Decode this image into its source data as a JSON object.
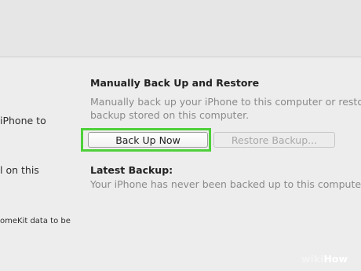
{
  "left_panel": {
    "lines": [
      "iPhone to",
      "l on this",
      "omeKit data to be"
    ]
  },
  "backup_section": {
    "heading": "Manually Back Up and Restore",
    "description_line1": "Manually back up your iPhone to this computer or restor",
    "description_line2": "backup stored on this computer.",
    "back_up_now_label": "Back Up Now",
    "restore_backup_label": "Restore Backup..."
  },
  "latest_backup": {
    "heading": "Latest Backup:",
    "status": "Your iPhone has never been backed up to this computer."
  },
  "watermark": {
    "prefix": "wiki",
    "suffix": "How"
  },
  "colors": {
    "highlight": "#4ed03a",
    "background": "#ededed"
  }
}
